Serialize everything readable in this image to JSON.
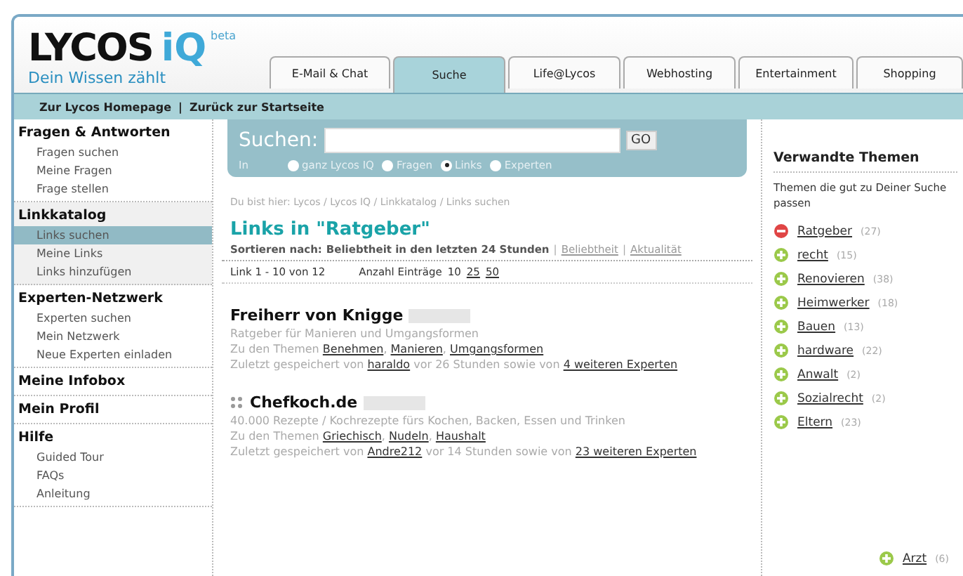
{
  "logo": {
    "name": "LYCOS",
    "mark": "iQ",
    "badge": "beta",
    "tagline": "Dein Wissen zählt"
  },
  "tabs": [
    {
      "label": "E-Mail & Chat",
      "selected": false
    },
    {
      "label": "Suche",
      "selected": true
    },
    {
      "label": "Life@Lycos",
      "selected": false
    },
    {
      "label": "Webhosting",
      "selected": false
    },
    {
      "label": "Entertainment",
      "selected": false
    },
    {
      "label": "Shopping",
      "selected": false
    }
  ],
  "top_links": [
    "Zur Lycos Homepage",
    "|",
    "Zurück zur Startseite"
  ],
  "sidebar": [
    {
      "title": "Fragen & Antworten",
      "items": [
        {
          "label": "Fragen suchen",
          "selected": false
        },
        {
          "label": "Meine Fragen",
          "selected": false
        },
        {
          "label": "Frage stellen",
          "selected": false
        }
      ]
    },
    {
      "title": "Linkkatalog",
      "items": [
        {
          "label": "Links suchen",
          "selected": true
        },
        {
          "label": "Meine Links",
          "selected": false
        },
        {
          "label": "Links hinzufügen",
          "selected": false
        }
      ]
    },
    {
      "title": "Experten-Netzwerk",
      "items": [
        {
          "label": "Experten suchen",
          "selected": false
        },
        {
          "label": "Mein Netzwerk",
          "selected": false
        },
        {
          "label": "Neue Experten einladen",
          "selected": false
        }
      ]
    },
    {
      "title": "Meine Infobox"
    },
    {
      "title": "Mein Profil"
    },
    {
      "title": "Hilfe",
      "items": [
        {
          "label": "Guided Tour",
          "selected": false
        },
        {
          "label": "FAQs",
          "selected": false
        },
        {
          "label": "Anleitung",
          "selected": false
        }
      ]
    }
  ],
  "search": {
    "label": "Suchen:",
    "button": "GO",
    "scope_label": "In",
    "options": [
      {
        "label": "ganz Lycos IQ",
        "selected": false
      },
      {
        "label": "Fragen",
        "selected": false
      },
      {
        "label": "Links",
        "selected": true
      },
      {
        "label": "Experten",
        "selected": false
      }
    ]
  },
  "breadcrumb": "Du bist hier: Lycos / Lycos IQ / Linkkatalog / Links suchen",
  "heading": "Links in \"Ratgeber\"",
  "sort": {
    "label": "Sortieren nach:",
    "current": "Beliebtheit in den letzten 24 Stunden",
    "separator": "|",
    "options": [
      "Beliebtheit",
      "Aktualität"
    ]
  },
  "paging": {
    "range": "Link 1 - 10 von 12",
    "count_label": "Anzahl Einträge",
    "counts": [
      {
        "label": "10",
        "selected": true
      },
      {
        "label": "25",
        "selected": false
      },
      {
        "label": "50",
        "selected": false
      }
    ]
  },
  "results": [
    {
      "title": "Freiherr von Knigge",
      "favicon": false,
      "description": "Ratgeber für Manieren und Umgangsformen",
      "topics_label": "Zu den Themen",
      "topic_separator": ",",
      "topics": [
        "Benehmen",
        "Manieren",
        "Umgangsformen"
      ],
      "saved_prefix": "Zuletzt gespeichert von",
      "user": "haraldo",
      "saved_middle": "vor 26 Stunden sowie von",
      "others": "4 weiteren Experten"
    },
    {
      "title": "Chefkoch.de",
      "favicon": true,
      "description": "40.000 Rezepte / Kochrezepte fürs Kochen, Backen, Essen und Trinken",
      "topics_label": "Zu den Themen",
      "topic_separator": ",",
      "topics": [
        "Griechisch",
        "Nudeln",
        "Haushalt"
      ],
      "saved_prefix": "Zuletzt gespeichert von",
      "user": "Andre212",
      "saved_middle": "vor 14 Stunden sowie von",
      "others": "23 weiteren Experten"
    }
  ],
  "related": {
    "title": "Verwandte Themen",
    "intro": "Themen die gut zu Deiner Suche passen",
    "topics": [
      {
        "label": "Ratgeber",
        "count": "(27)",
        "selected": true
      },
      {
        "label": "recht",
        "count": "(15)",
        "selected": false
      },
      {
        "label": "Renovieren",
        "count": "(38)",
        "selected": false
      },
      {
        "label": "Heimwerker",
        "count": "(18)",
        "selected": false
      },
      {
        "label": "Bauen",
        "count": "(13)",
        "selected": false
      },
      {
        "label": "hardware",
        "count": "(22)",
        "selected": false
      },
      {
        "label": "Anwalt",
        "count": "(2)",
        "selected": false
      },
      {
        "label": "Sozialrecht",
        "count": "(2)",
        "selected": false
      },
      {
        "label": "Eltern",
        "count": "(23)",
        "selected": false
      }
    ],
    "extra_topic": {
      "label": "Arzt",
      "count": "(6)",
      "selected": false
    }
  }
}
